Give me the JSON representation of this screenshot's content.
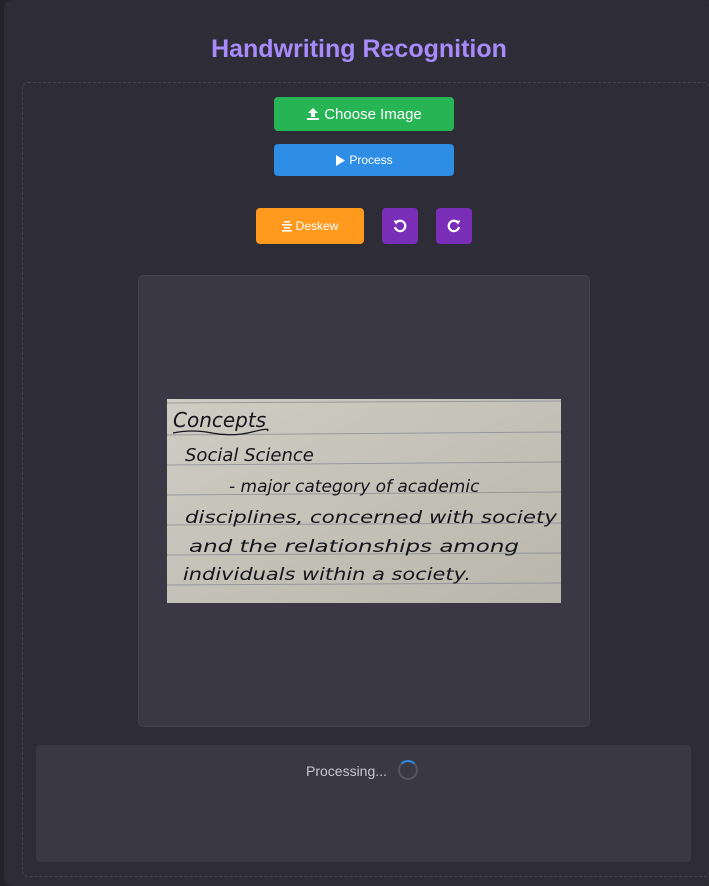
{
  "app": {
    "title": "Handwriting Recognition"
  },
  "toolbar": {
    "choose_label": "Choose Image",
    "process_label": "Process",
    "deskew_label": "Deskew",
    "rotate_left_icon": "rotate-left-icon",
    "rotate_right_icon": "rotate-right-icon"
  },
  "image": {
    "lines": [
      "Concepts",
      "Social Science",
      "- major category of academic",
      "disciplines, concerned with society",
      "and the relationships among",
      "individuals within a society."
    ]
  },
  "status": {
    "text": "Processing..."
  },
  "colors": {
    "title": "#a78bfa",
    "choose": "#27b455",
    "process": "#2e8ee6",
    "deskew": "#ff9a1f",
    "rotate": "#7a2eb8"
  }
}
